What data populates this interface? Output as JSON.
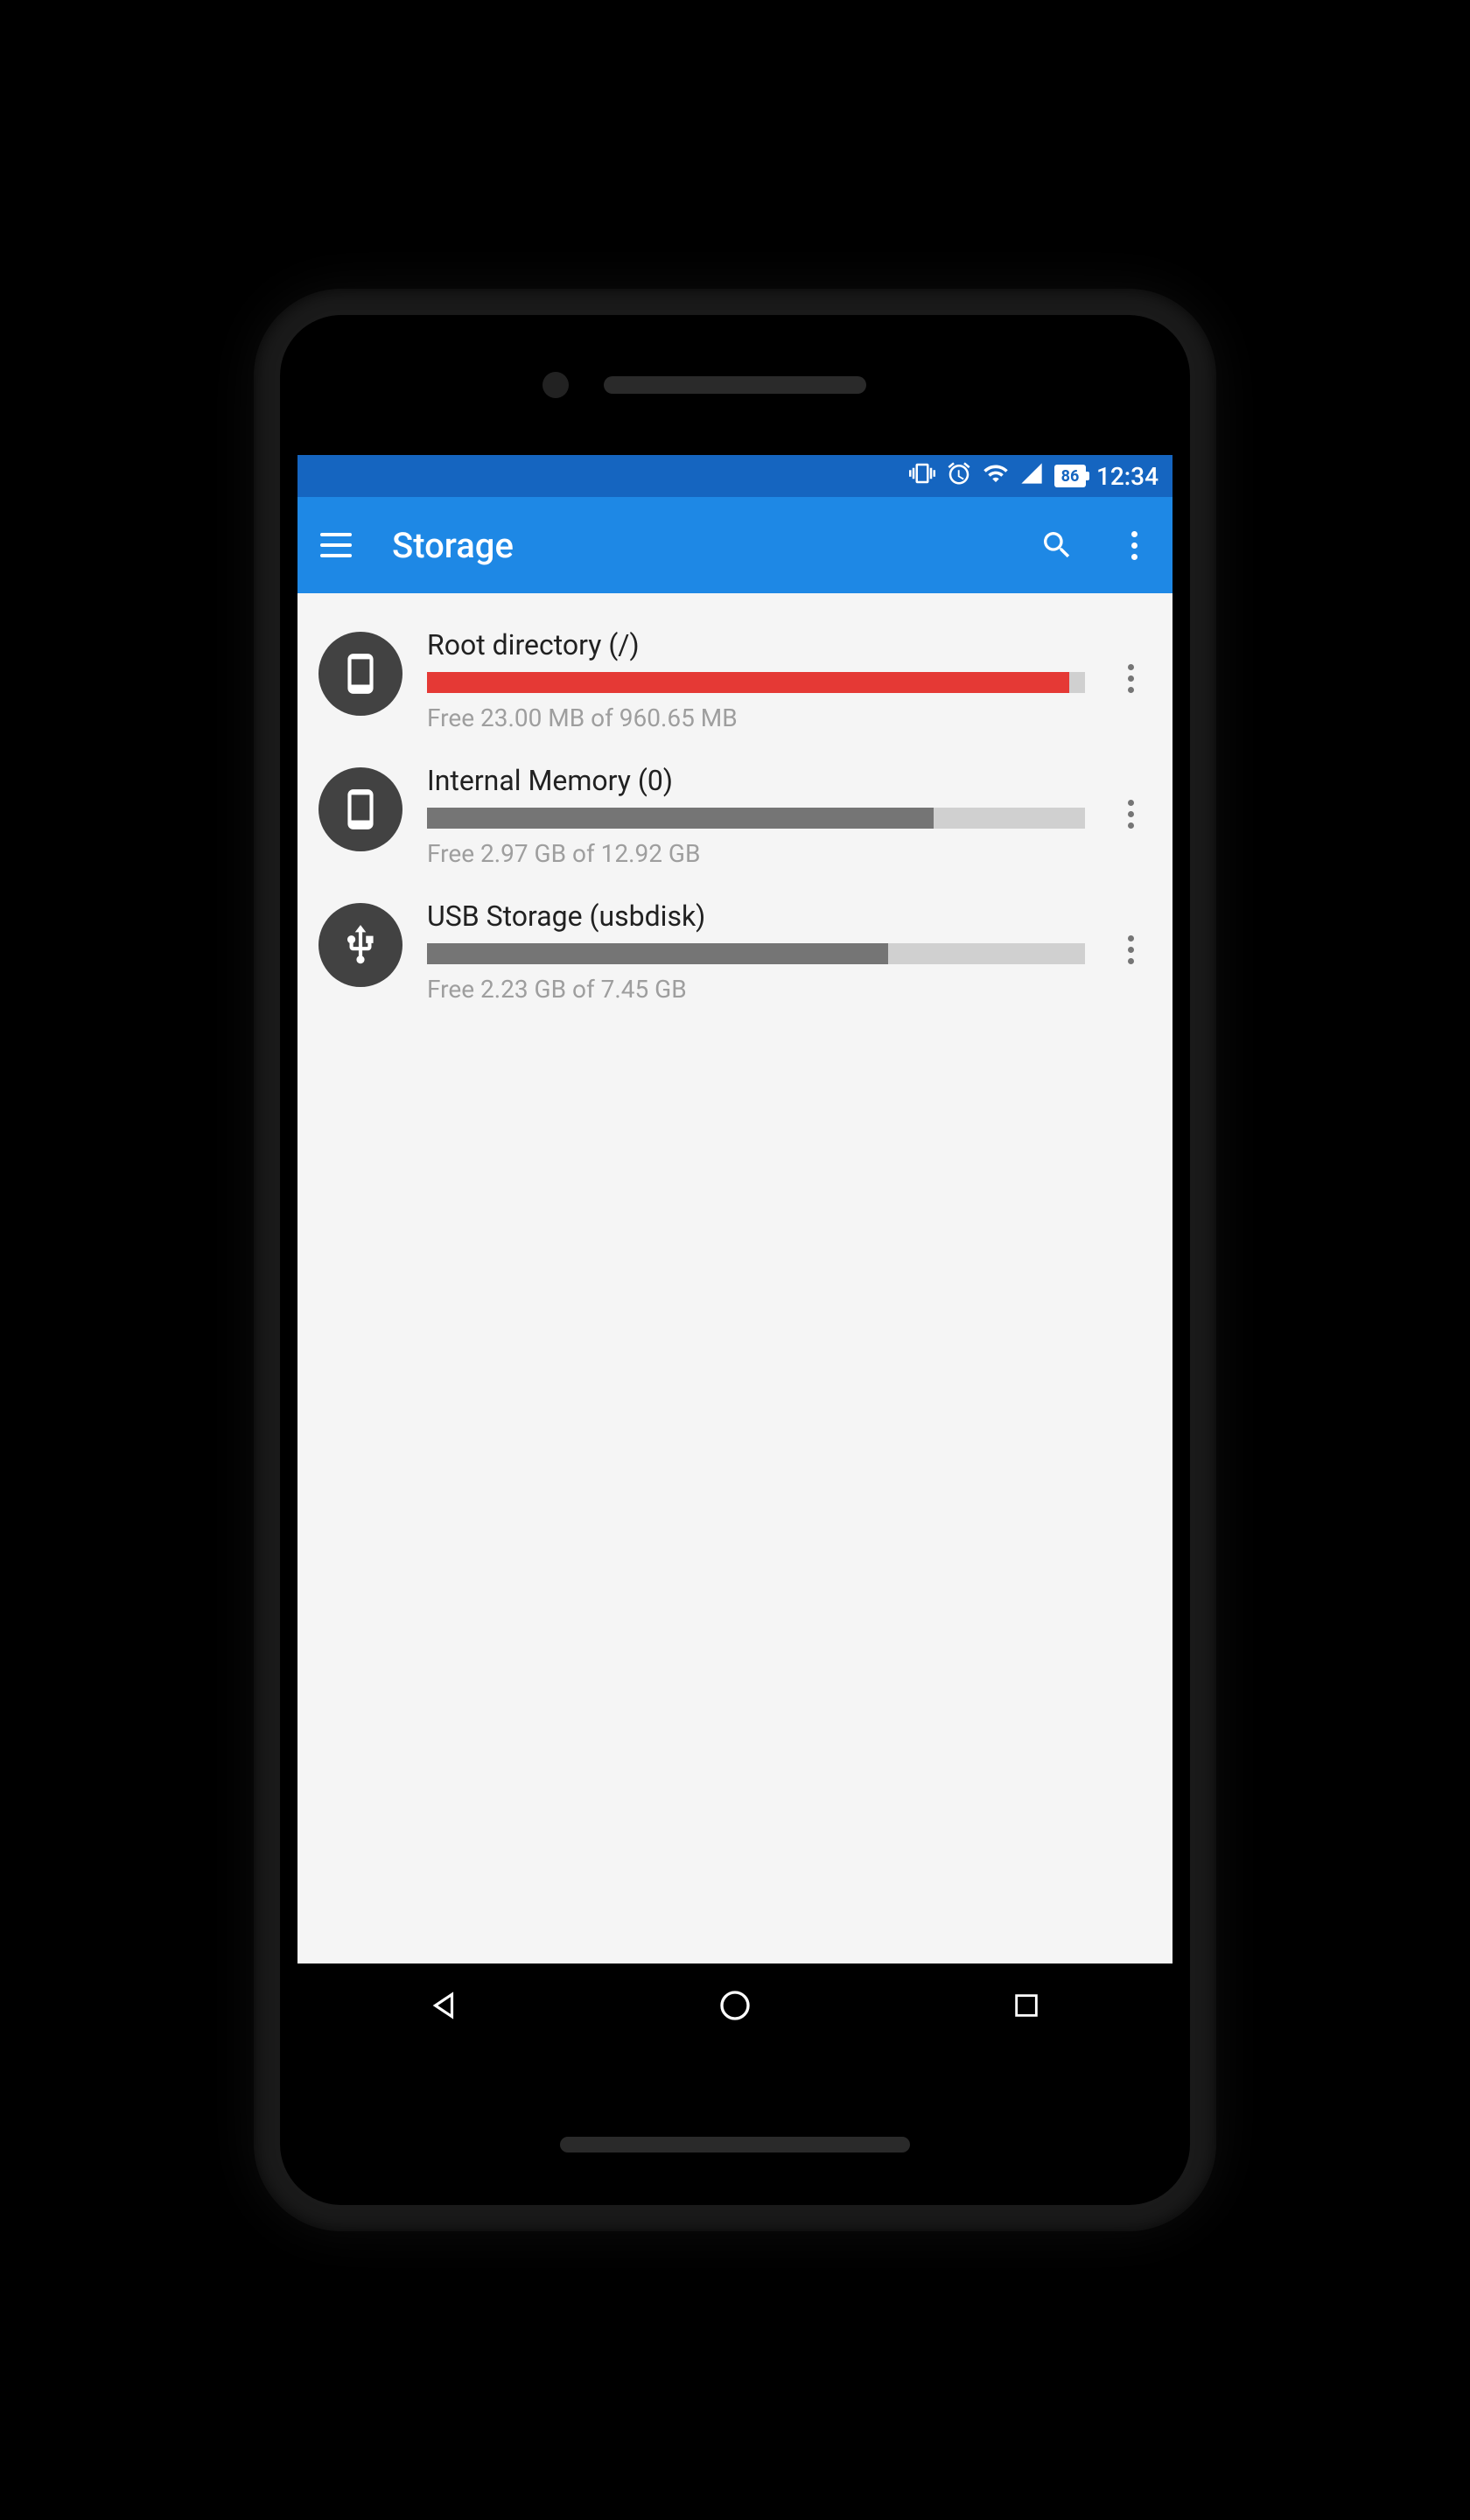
{
  "status": {
    "battery_pct": "86",
    "time": "12:34"
  },
  "appbar": {
    "title": "Storage"
  },
  "storage": {
    "items": [
      {
        "title": "Root directory (/)",
        "free_text": "Free 23.00 MB of 960.65 MB",
        "used_pct": 97.6,
        "bar_color": "red",
        "icon": "phone"
      },
      {
        "title": "Internal Memory (0)",
        "free_text": "Free 2.97 GB of 12.92 GB",
        "used_pct": 77.0,
        "bar_color": "gray",
        "icon": "phone"
      },
      {
        "title": "USB Storage (usbdisk)",
        "free_text": "Free 2.23 GB of 7.45 GB",
        "used_pct": 70.1,
        "bar_color": "gray",
        "icon": "usb"
      }
    ]
  }
}
